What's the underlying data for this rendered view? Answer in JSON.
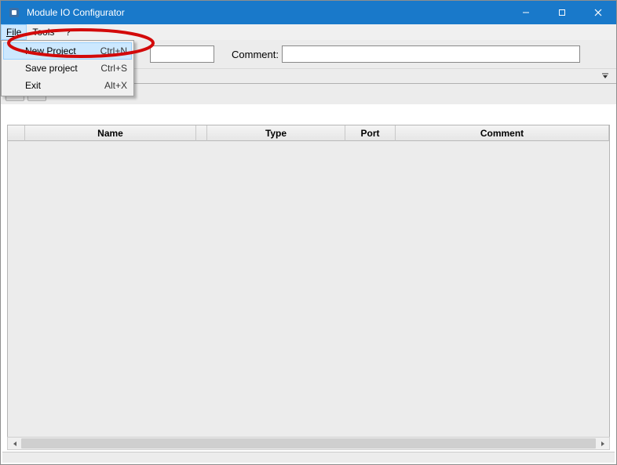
{
  "window": {
    "title": "Module IO Configurator"
  },
  "menubar": {
    "items": [
      {
        "label": "File",
        "underline_index": 0
      },
      {
        "label": "Tools"
      },
      {
        "label": "?"
      }
    ]
  },
  "file_menu": {
    "items": [
      {
        "label": "New Project",
        "shortcut": "Ctrl+N",
        "highlight": true
      },
      {
        "label": "Save project",
        "shortcut": "Ctrl+S"
      },
      {
        "label": "Exit",
        "shortcut": "Alt+X"
      }
    ]
  },
  "fields": {
    "name_value": "",
    "comment_label": "Comment:",
    "comment_value": ""
  },
  "table": {
    "headers": {
      "name": "Name",
      "type": "Type",
      "port": "Port",
      "comment": "Comment"
    },
    "rows": []
  }
}
